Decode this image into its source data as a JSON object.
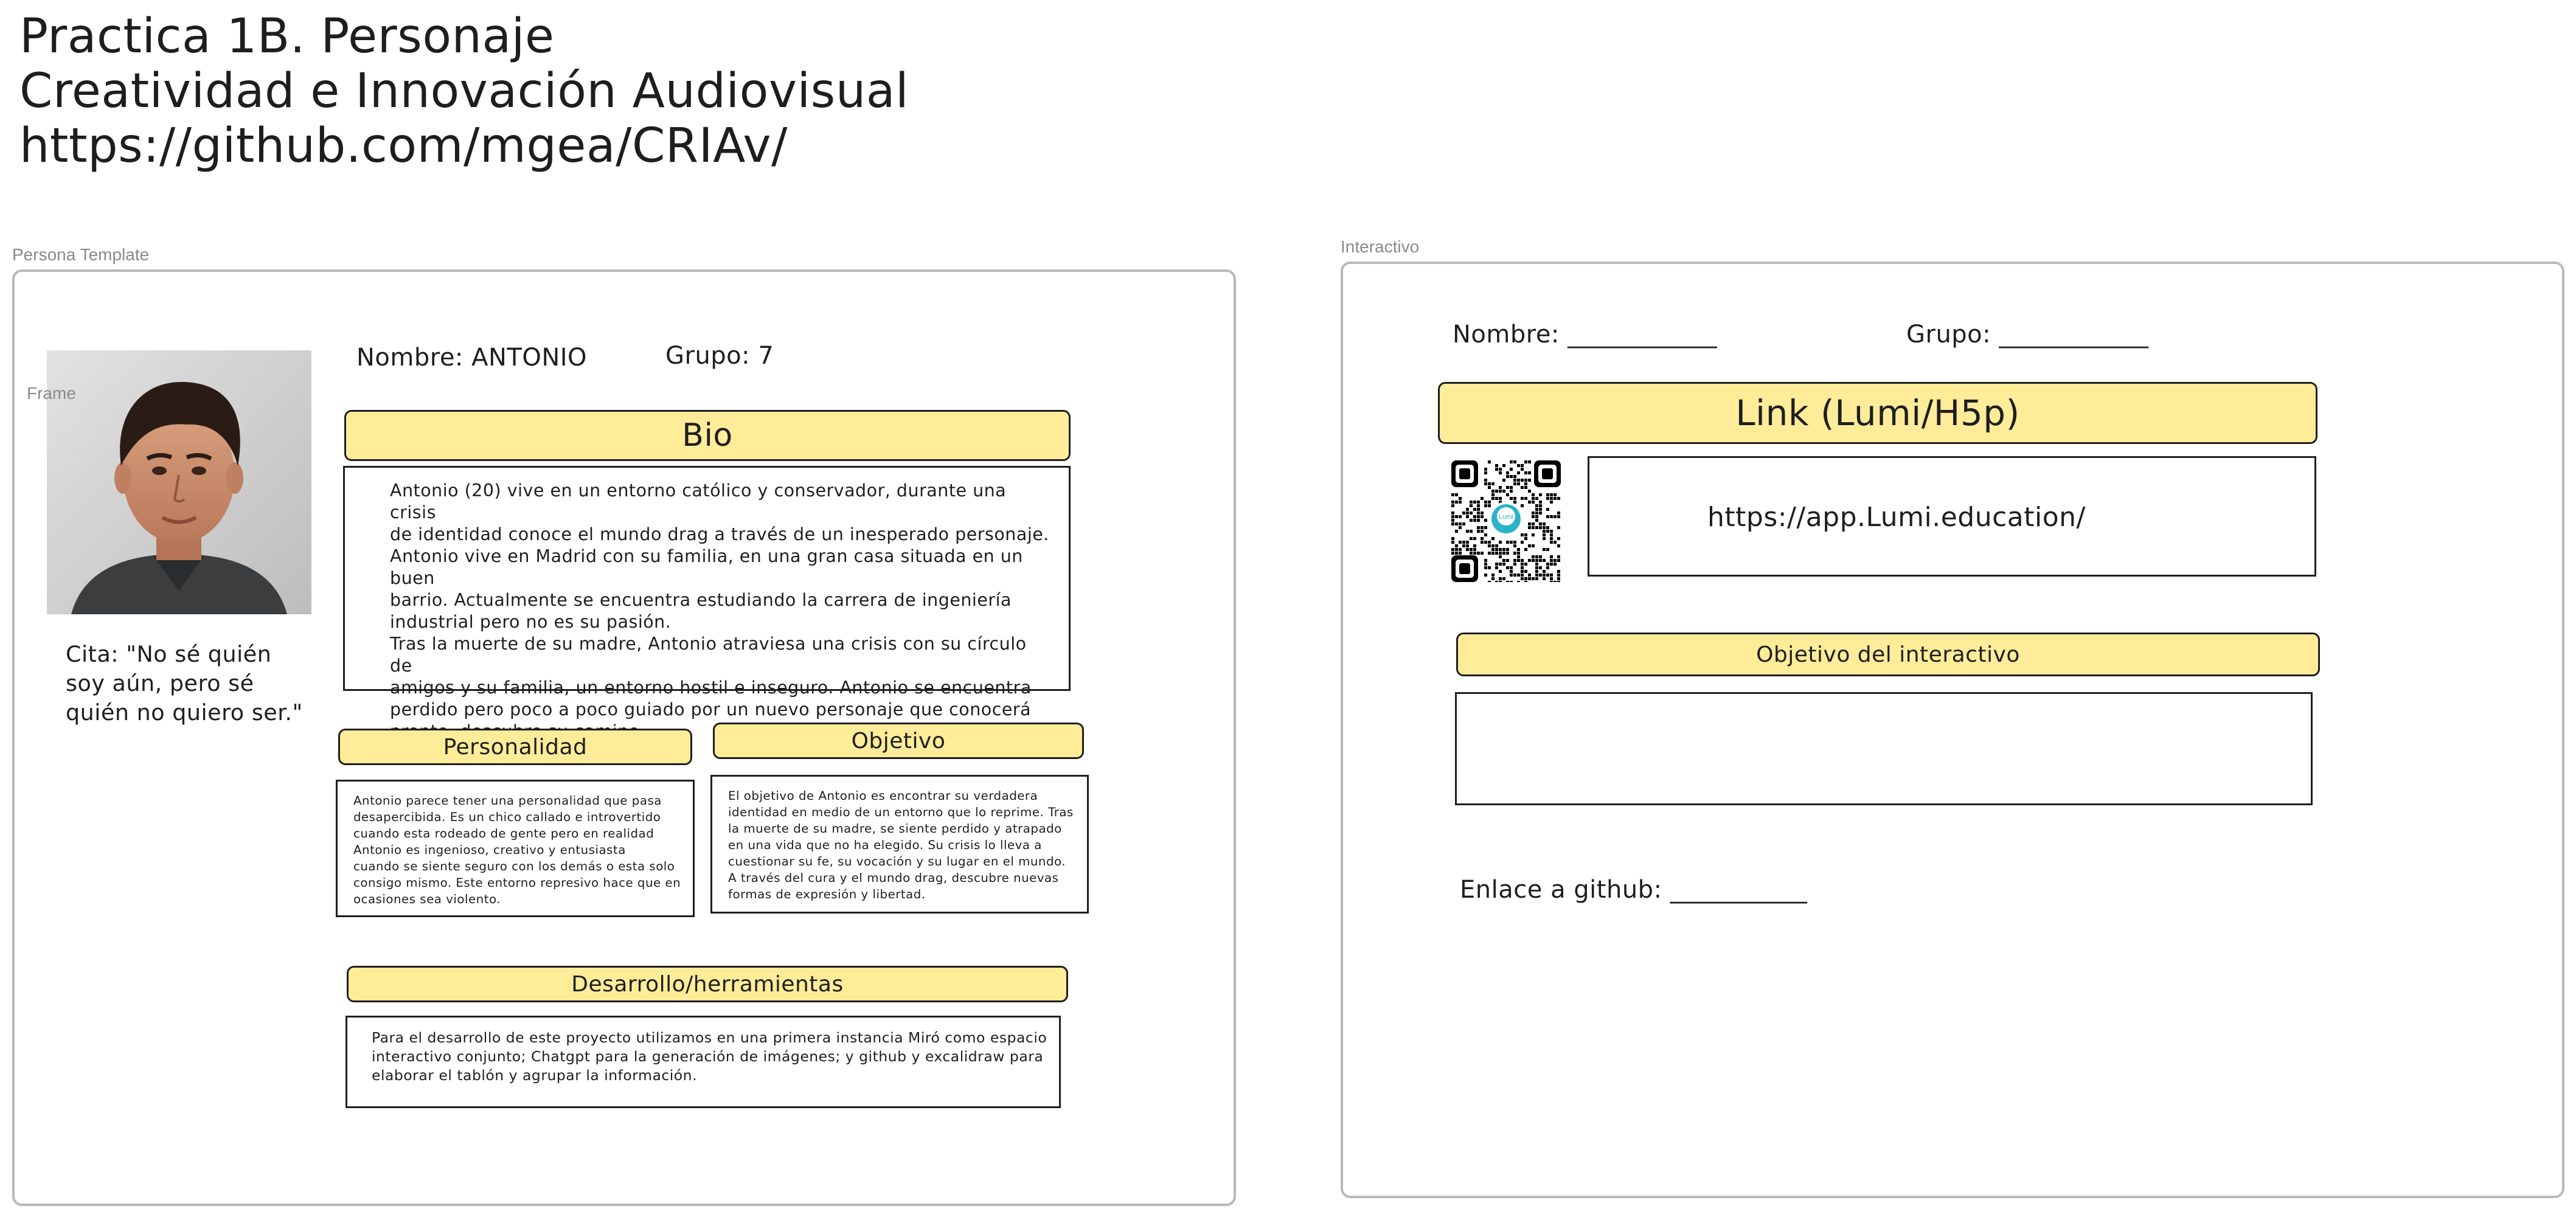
{
  "header": {
    "line1": "Practica 1B. Personaje",
    "line2": "Creatividad e Innovación Audiovisual",
    "line3": "https://github.com/mgea/CRIAv/"
  },
  "persona": {
    "frame_label": "Persona Template",
    "inner_frame_label": "Frame",
    "nombre": "Nombre: ANTONIO",
    "grupo": "Grupo: 7",
    "quote": "Cita: \"No sé quién\nsoy aún, pero sé\nquién no quiero ser.\"",
    "bio_title": "Bio",
    "bio_text": "Antonio (20) vive en un entorno católico y conservador, durante una crisis\nde identidad conoce el mundo drag a través de un inesperado personaje.\nAntonio vive en Madrid con su familia, en una gran casa situada en un buen\nbarrio. Actualmente se encuentra estudiando la carrera de ingeniería\nindustrial  pero no es su pasión.\nTras la muerte de su madre, Antonio atraviesa una crisis con su círculo de\namigos y su familia, un entorno hostil e inseguro. Antonio se encuentra\nperdido pero poco a poco guiado por un nuevo personaje que conocerá\npronto, descubre su camino.",
    "personalidad_title": "Personalidad",
    "personalidad_text": "Antonio parece tener una personalidad que pasa\ndesapercibida. Es un chico callado e  introvertido\ncuando esta rodeado de gente pero en realidad\nAntonio es ingenioso, creativo y entusiasta\ncuando se siente seguro con los demás o esta solo\nconsigo mismo. Este entorno represivo hace que en\nocasiones sea violento.",
    "objetivo_title": "Objetivo",
    "objetivo_text": "El objetivo de Antonio es encontrar su verdadera\nidentidad en medio de un entorno que lo reprime. Tras\nla muerte de su madre, se siente perdido y atrapado\nen una vida que no ha elegido. Su crisis lo lleva a\ncuestionar su fe, su vocación y su lugar en el mundo.\nA través del cura y el mundo drag, descubre nuevas\nformas de expresión y libertad.",
    "desarrollo_title": "Desarrollo/herramientas",
    "desarrollo_text": "Para el desarrollo de este proyecto utilizamos en una primera instancia Miró como espacio\ninteractivo conjunto; Chatgpt para la generación de imágenes; y github y excalidraw para\nelaborar el tablón y agrupar la información."
  },
  "interactivo": {
    "frame_label": "Interactivo",
    "nombre": "Nombre: ____________",
    "grupo": "Grupo: ____________",
    "link_title": "Link (Lumi/H5p)",
    "link_url": "https://app.Lumi.education/",
    "qr_logo_text": "Lumi",
    "objetivo_title": "Objetivo del interactivo",
    "objetivo_text": "",
    "github": "Enlace a github: ___________"
  },
  "colors": {
    "header_fill": "#ffec99",
    "stroke": "#1e1e1e",
    "frame_border": "#b9b9b9",
    "label_gray": "#8a8a8a"
  }
}
